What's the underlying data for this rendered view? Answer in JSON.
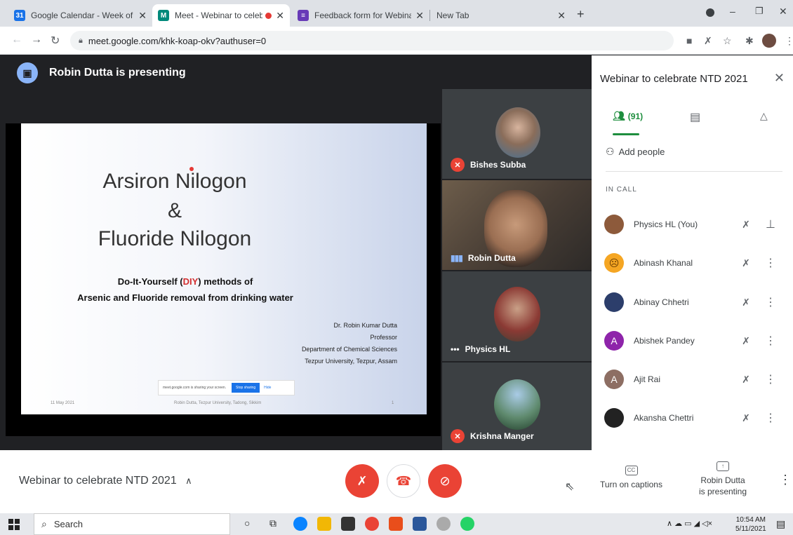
{
  "browser": {
    "tabs": [
      {
        "title": "Google Calendar - Week of May",
        "fav_color": "#1a73e8",
        "fav_text": "31"
      },
      {
        "title": "Meet - Webinar to celebrate",
        "fav_color": "#00897b",
        "fav_text": "M"
      },
      {
        "title": "Feedback form for Webinar on th",
        "fav_color": "#673ab7",
        "fav_text": "≡"
      },
      {
        "title": "New Tab",
        "fav_color": "",
        "fav_text": ""
      }
    ],
    "url": "meet.google.com/khk-koap-okv?authuser=0"
  },
  "meet": {
    "presenter_banner": "Robin Dutta is presenting",
    "slide": {
      "title_line1": "Arsiron Nilogon",
      "title_line2": "&",
      "title_line3": "Fluoride Nilogon",
      "subtitle_pre": "Do-It-Yourself (",
      "subtitle_red": "DIY",
      "subtitle_post": ") methods of",
      "subtitle_line2": "Arsenic and Fluoride removal from drinking water",
      "credit_name": "Dr. Robin Kumar Dutta",
      "credit_role": "Professor",
      "credit_dept": "Department of Chemical Sciences",
      "credit_univ": "Tezpur University, Tezpur, Assam",
      "footer_date": "11 May 2021",
      "footer_center": "Robin Dutta, Tezpur University, Tadong, Sikkim",
      "footer_page": "1",
      "share_popup_text": "meet.google.com is sharing your screen.",
      "share_popup_stop": "Stop sharing",
      "share_popup_hide": "Hide"
    },
    "tiles": [
      {
        "name": "Bishes Subba"
      },
      {
        "name": "Robin Dutta"
      },
      {
        "name": "Physics HL"
      },
      {
        "name": "Krishna Manger"
      }
    ]
  },
  "panel": {
    "title": "Webinar to celebrate NTD 2021",
    "people_count": "(91)",
    "add_people": "Add people",
    "in_call_label": "IN CALL",
    "participants": [
      {
        "name": "Physics HL (You)",
        "initial": "",
        "color": "#8d5a3b"
      },
      {
        "name": "Abinash Khanal",
        "initial": "☹",
        "color": "#f5a623"
      },
      {
        "name": "Abinay Chhetri",
        "initial": "",
        "color": "#2c3e6b"
      },
      {
        "name": "Abishek Pandey",
        "initial": "A",
        "color": "#8e24aa"
      },
      {
        "name": "Ajit Rai",
        "initial": "A",
        "color": "#8d6e63"
      },
      {
        "name": "Akansha Chettri",
        "initial": "",
        "color": "#222"
      }
    ]
  },
  "bottom": {
    "meeting_name": "Webinar to celebrate NTD 2021",
    "captions_label": "Turn on captions",
    "presenting_line1": "Robin Dutta",
    "presenting_line2": "is presenting"
  },
  "taskbar": {
    "search_placeholder": "Search",
    "time": "10:54 AM",
    "date": "5/11/2021"
  }
}
